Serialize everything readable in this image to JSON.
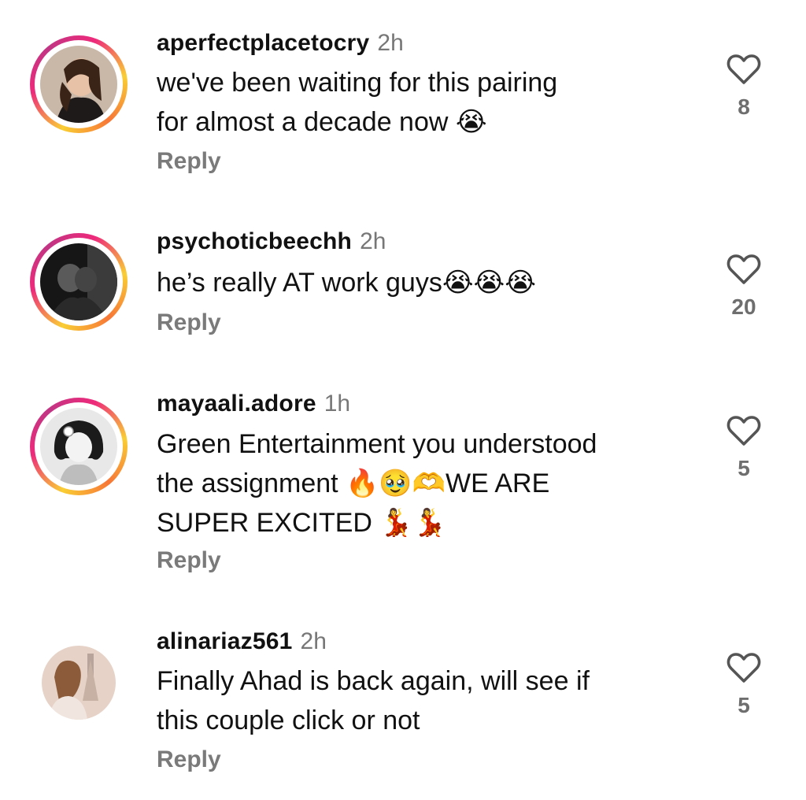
{
  "comments": [
    {
      "username": "aperfectplacetocry",
      "time": "2h",
      "text_lines": [
        "we've been waiting for this pairing",
        "for almost a decade now 😭"
      ],
      "reply_label": "Reply",
      "likes": "8",
      "story_ring": true
    },
    {
      "username": "psychoticbeechh",
      "time": "2h",
      "text_lines": [
        "he’s really AT work guys😭😭😭"
      ],
      "reply_label": "Reply",
      "likes": "20",
      "story_ring": true
    },
    {
      "username": "mayaali.adore",
      "time": "1h",
      "text_lines": [
        "Green Entertainment you understood",
        "the assignment 🔥🥹🫶WE ARE",
        "SUPER EXCITED 💃💃"
      ],
      "reply_label": "Reply",
      "likes": "5",
      "story_ring": true
    },
    {
      "username": "alinariaz561",
      "time": "2h",
      "text_lines": [
        "Finally Ahad is back again, will see if",
        "this couple click or not"
      ],
      "reply_label": "Reply",
      "likes": "5",
      "story_ring": false
    }
  ],
  "icons": {
    "like": "heart-outline-icon"
  },
  "colors": {
    "story_ring_start": "#f9ce34",
    "story_ring_end": "#ee2a7b",
    "muted": "#7a7a7a"
  }
}
